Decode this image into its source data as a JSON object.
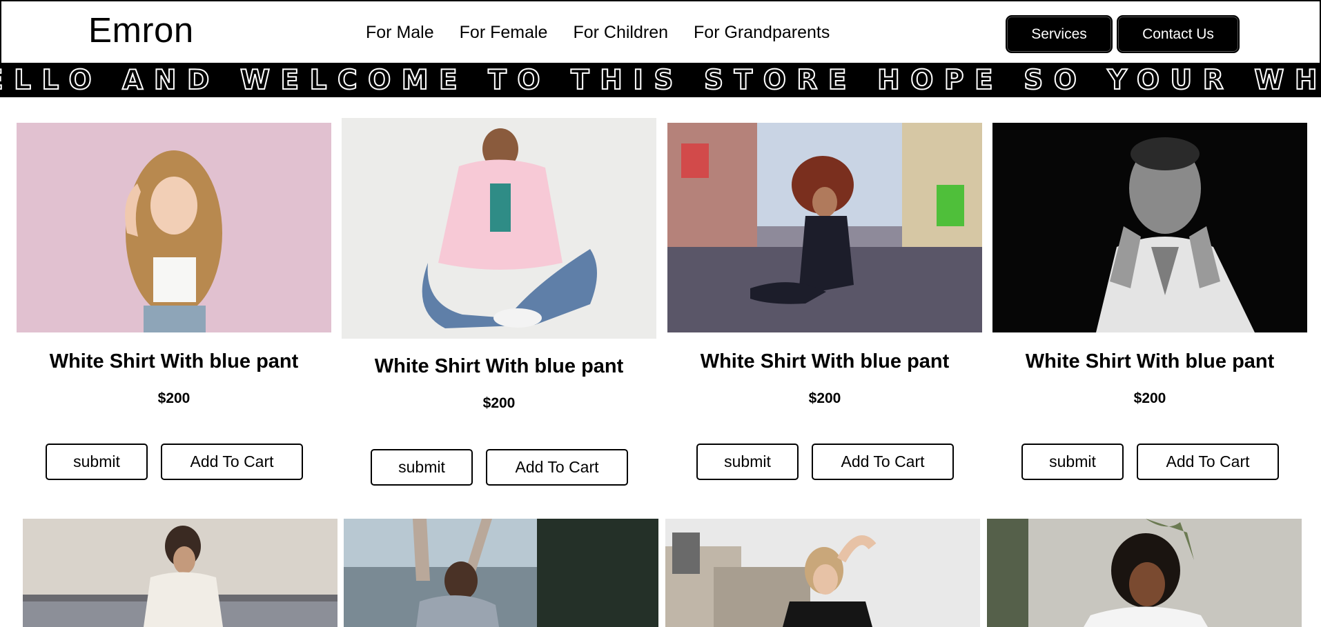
{
  "header": {
    "logo": "Emron",
    "nav": [
      "For Male",
      "For Female",
      "For Children",
      "For Grandparents"
    ],
    "services_label": "Services",
    "contact_label": "Contact Us"
  },
  "marquee": {
    "text": "ELLO AND WELCOME TO THIS STORE HOPE SO YOUR WHOLE DAY"
  },
  "products": [
    {
      "title": "White Shirt With blue pant",
      "price": "$200",
      "submit_label": "submit",
      "cart_label": "Add To Cart"
    },
    {
      "title": "White Shirt With blue pant",
      "price": "$200",
      "submit_label": "submit",
      "cart_label": "Add To Cart"
    },
    {
      "title": "White Shirt With blue pant",
      "price": "$200",
      "submit_label": "submit",
      "cart_label": "Add To Cart"
    },
    {
      "title": "White Shirt With blue pant",
      "price": "$200",
      "submit_label": "submit",
      "cart_label": "Add To Cart"
    }
  ],
  "colors": {
    "primary": "#000000",
    "background": "#ffffff"
  }
}
